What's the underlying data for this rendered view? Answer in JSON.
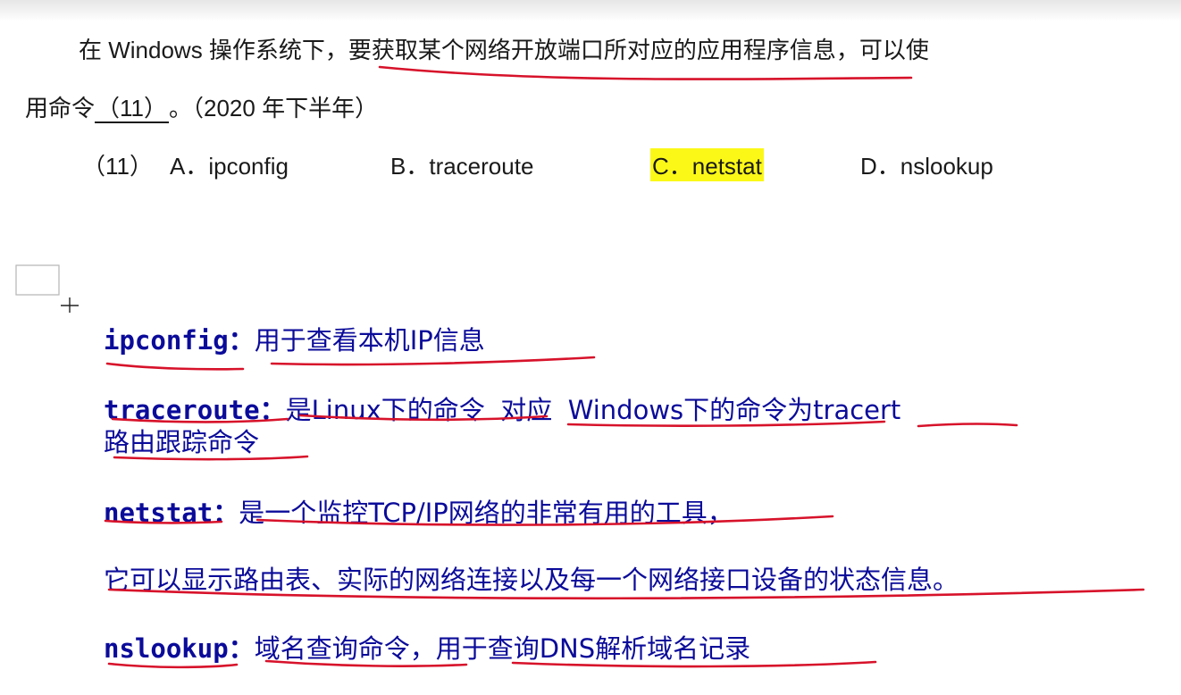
{
  "question": {
    "line1": "在 Windows 操作系统下，要获取某个网络开放端口所对应的应用程序信息，可以使",
    "line2_prefix": "用命令",
    "blank": "（11）",
    "line2_suffix": "。（2020 年下半年）"
  },
  "options": {
    "label": "（11）",
    "a": "A．ipconfig",
    "b": "B．traceroute",
    "c": "C．netstat",
    "d": "D．nslookup",
    "highlight_color": "#fbf817"
  },
  "notes": {
    "ipconfig": {
      "term": "ipconfig：",
      "desc": "用于查看本机IP信息"
    },
    "traceroute": {
      "term": "traceroute：",
      "desc_a": "是Linux下的命令",
      "desc_b": "对应",
      "desc_c": "Windows下的命令为tracert",
      "desc2": "路由跟踪命令"
    },
    "netstat": {
      "term": "netstat：",
      "desc": "是一个监控TCP/IP网络的非常有用的工具，",
      "desc2": "它可以显示路由表、实际的网络连接以及每一个网络接口设备的状态信息。"
    },
    "nslookup": {
      "term": "nslookup：",
      "desc": "域名查询命令，用于查询DNS解析域名记录"
    }
  },
  "colors": {
    "annotation_text": "#0b0b9a",
    "pen_underline": "#d7122a"
  }
}
